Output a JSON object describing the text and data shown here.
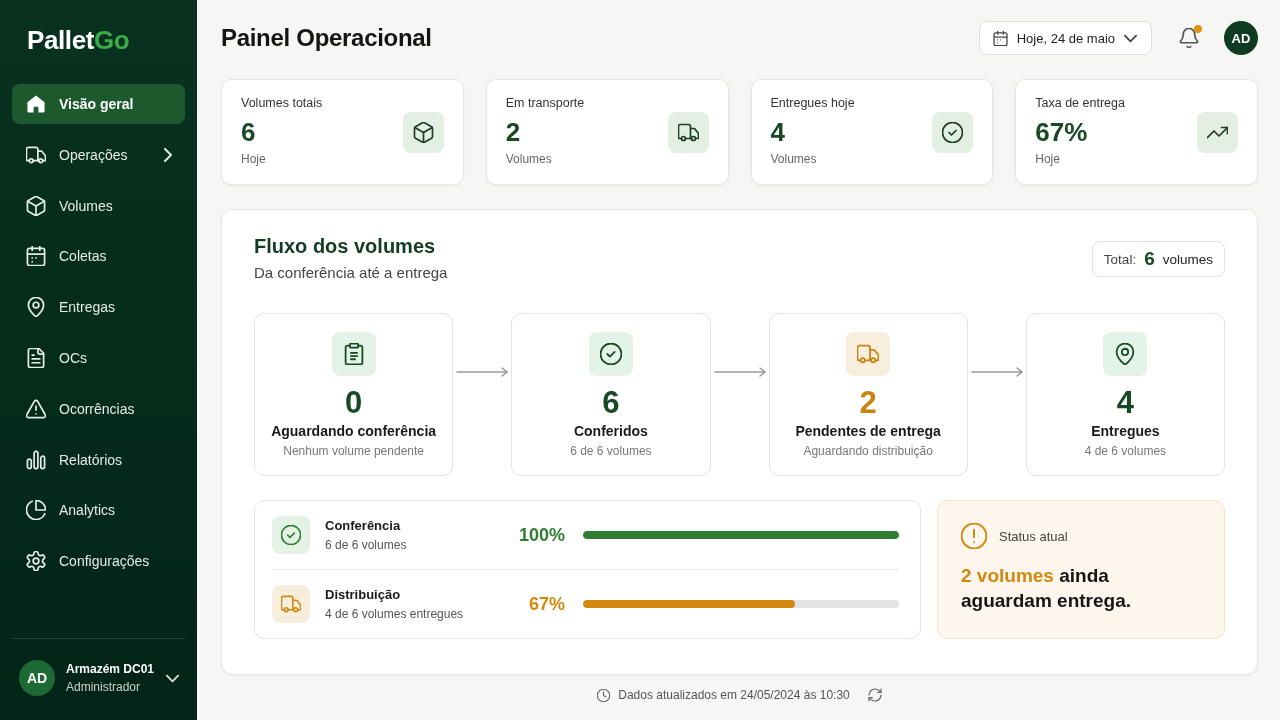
{
  "sidebar": {
    "logo": {
      "first": "Pallet",
      "accent": "Go"
    },
    "items": [
      {
        "label": "Visão geral",
        "selected": true,
        "has_submenu": false
      },
      {
        "label": "Operações",
        "selected": false,
        "has_submenu": true
      },
      {
        "label": "Volumes",
        "selected": false,
        "has_submenu": false
      },
      {
        "label": "Coletas",
        "selected": false,
        "has_submenu": false
      },
      {
        "label": "Entregas",
        "selected": false,
        "has_submenu": false
      },
      {
        "label": "OCs",
        "selected": false,
        "has_submenu": false
      },
      {
        "label": "Ocorrências",
        "selected": false,
        "has_submenu": false
      },
      {
        "label": "Relatórios",
        "selected": false,
        "has_submenu": false
      },
      {
        "label": "Analytics",
        "selected": false,
        "has_submenu": false
      },
      {
        "label": "Configurações",
        "selected": false,
        "has_submenu": false
      }
    ],
    "user": {
      "initials": "AD",
      "name": "Armazém DC01",
      "role": "Administrador"
    }
  },
  "header": {
    "title": "Painel Operacional",
    "date_picker": {
      "value": "Hoje, 24 de maio"
    },
    "notifications": {
      "unread": true
    },
    "avatar": {
      "initials": "AD"
    }
  },
  "stat_cards": [
    {
      "label": "Volumes totais",
      "value": "6",
      "caption": "Hoje"
    },
    {
      "label": "Em transporte",
      "value": "2",
      "caption": "Volumes"
    },
    {
      "label": "Entregues hoje",
      "value": "4",
      "caption": "Volumes"
    },
    {
      "label": "Taxa de entrega",
      "value": "67%",
      "caption": "Hoje"
    }
  ],
  "flow": {
    "title": "Fluxo dos volumes",
    "subtitle": "Da conferência até a entrega",
    "total": {
      "label": "Total:",
      "value": "6",
      "unit": "volumes"
    },
    "steps": [
      {
        "count": "0",
        "title": "Aguardando conferência",
        "caption": "Nenhum volume pendente",
        "color": "#174a24"
      },
      {
        "count": "6",
        "title": "Conferidos",
        "caption": "6 de 6 volumes",
        "color": "#174a24"
      },
      {
        "count": "2",
        "title": "Pendentes de entrega",
        "caption": "Aguardando distribuição",
        "color": "#c9830f"
      },
      {
        "count": "4",
        "title": "Entregues",
        "caption": "4 de 6 volumes",
        "color": "#174a24"
      }
    ],
    "progress": [
      {
        "label": "Conferência",
        "caption": "6 de 6 volumes",
        "percent": "100%",
        "level": 1,
        "color": "#2e7d32"
      },
      {
        "label": "Distribuição",
        "caption": "4 de 6 volumes entregues",
        "percent": "67%",
        "level": 0.67,
        "color": "#d4880f"
      }
    ],
    "status": {
      "label": "Status atual",
      "highlight": "2 volumes",
      "rest": "ainda aguardam entrega."
    }
  },
  "footer": {
    "updated_text": "Dados atualizados em 24/05/2024 às 10:30"
  }
}
